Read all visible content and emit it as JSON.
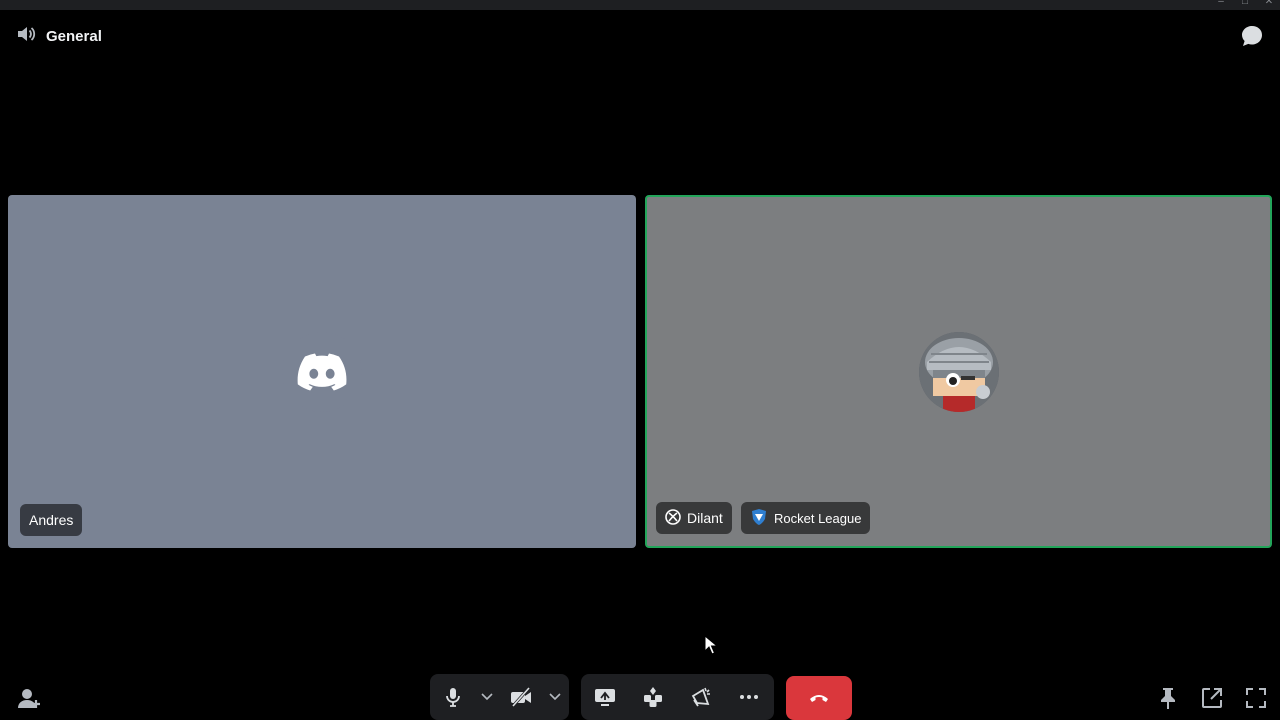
{
  "window": {
    "controls": [
      "minimize",
      "maximize",
      "close"
    ]
  },
  "header": {
    "channel_name": "General",
    "channel_icon": "speaker-icon",
    "chat_icon": "chat-bubble-icon"
  },
  "tiles": [
    {
      "user": "Andres",
      "avatar": "discord-logo-icon",
      "speaking": false,
      "bg": "#7a8394"
    },
    {
      "user": "Dilant",
      "platform_icon": "xbox-icon",
      "activity": "Rocket League",
      "activity_icon": "rocket-league-icon",
      "avatar": "pixel-character-avatar",
      "speaking": true,
      "bg": "#7c7e80",
      "speaking_color": "#23a55a"
    }
  ],
  "bottom_left": {
    "icon": "add-person-icon"
  },
  "controls": {
    "mic": "microphone-icon",
    "camera": "camera-off-icon",
    "screen_share": "screen-share-icon",
    "activities": "activities-icon",
    "soundboard": "soundboard-icon",
    "more": "more-icon",
    "disconnect": "hang-up-icon",
    "disconnect_color": "#da373c"
  },
  "right_tools": [
    "pin-icon",
    "popout-icon",
    "fullscreen-icon"
  ]
}
